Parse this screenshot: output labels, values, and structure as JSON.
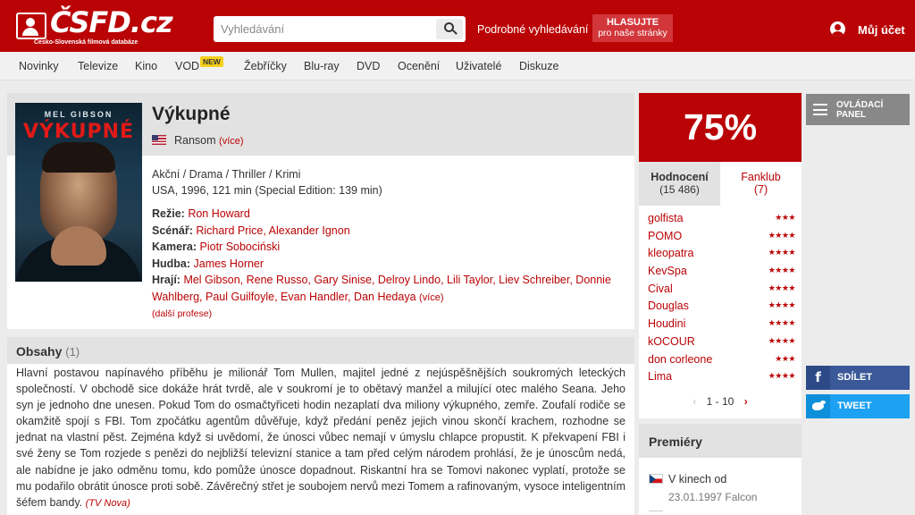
{
  "header": {
    "logo_text": "ČSFD.cz",
    "logo_subtitle": "Česko-Slovenská filmová databáze",
    "search_placeholder": "Vyhledávání",
    "advanced_search": "Podrobné vyhledávání",
    "vote_line1": "HLASUJTE",
    "vote_line2": "pro naše stránky",
    "account": "Můj účet"
  },
  "nav": {
    "items": [
      "Novinky",
      "Televize",
      "Kino",
      "VOD",
      "Žebříčky",
      "Blu-ray",
      "DVD",
      "Ocenění",
      "Uživatelé",
      "Diskuze"
    ],
    "new_badge": "NEW"
  },
  "film": {
    "poster_actor": "MEL GIBSON",
    "poster_title": "VÝKUPNÉ",
    "title": "Výkupné",
    "original_title": "Ransom",
    "more_link": "(více)",
    "genres": "Akční / Drama / Thriller / Krimi",
    "origin": "USA, 1996, 121 min (Special Edition: 139 min)",
    "director_label": "Režie:",
    "director": "Ron Howard",
    "writers_label": "Scénář:",
    "writers": "Richard Price, Alexander Ignon",
    "camera_label": "Kamera:",
    "camera": "Piotr Sobociński",
    "music_label": "Hudba:",
    "music": "James Horner",
    "cast_label": "Hrají:",
    "cast": "Mel Gibson, Rene Russo, Gary Sinise, Delroy Lindo, Lili Taylor, Liev Schreiber, Donnie Wahlberg, Paul Guilfoyle, Evan Handler, Dan Hedaya",
    "cast_more": "(více)",
    "other_professions": "(další profese)"
  },
  "plot": {
    "title": "Obsahy",
    "count": "(1)",
    "text": "Hlavní postavou napínavého příběhu je milionář Tom Mullen, majitel jedné z nejúspěšnějších soukromých leteckých společností. V obchodě sice dokáže hrát tvrdě, ale v soukromí je to obětavý manžel a milující otec malého Seana. Jeho syn je jednoho dne unesen. Pokud Tom do osmačtyřiceti hodin nezaplatí dva miliony výkupného, zemře. Zoufalí rodiče se okamžitě spojí s FBI. Tom zpočátku agentům důvěřuje, když předání peněz jejich vinou skončí krachem, rozhodne se jednat na vlastní pěst. Zejména když si uvědomí, že únosci vůbec nemají v úmyslu chlapce propustit. K překvapení FBI i své ženy se Tom rozjede s penězi do nejbližší televizní stanice a tam před celým národem prohlásí, že je únoscům nedá, ale nabídne je jako odměnu tomu, kdo pomůže únosce dopadnout. Riskantní hra se Tomovi nakonec vyplatí, protože se mu podařilo obrátit únosce proti sobě. Závěrečný střet je soubojem nervů mezi Tomem a rafinovaným, vysoce inteligentním šéfem bandy.",
    "source": "(TV Nova)"
  },
  "rating": {
    "percent": "75%",
    "tab_ratings_label": "Hodnocení",
    "tab_ratings_count": "(15 486)",
    "tab_fanclub_label": "Fanklub",
    "tab_fanclub_count": "(7)",
    "users": [
      {
        "name": "golfista",
        "stars": "★★★"
      },
      {
        "name": "POMO",
        "stars": "★★★★"
      },
      {
        "name": "kleopatra",
        "stars": "★★★★"
      },
      {
        "name": "KevSpa",
        "stars": "★★★★"
      },
      {
        "name": "Cival",
        "stars": "★★★★"
      },
      {
        "name": "Douglas",
        "stars": "★★★★"
      },
      {
        "name": "Houdini",
        "stars": "★★★★"
      },
      {
        "name": "kOCOUR",
        "stars": "★★★★"
      },
      {
        "name": "don corleone",
        "stars": "★★★"
      },
      {
        "name": "Lima",
        "stars": "★★★★"
      }
    ],
    "pager": "1 - 10"
  },
  "premieres": {
    "title": "Premiéry",
    "item_label": "V kinech od",
    "item_detail": "23.01.1997 Falcon"
  },
  "sidebar": {
    "control_panel_line1": "OVLÁDACÍ",
    "control_panel_line2": "PANEL",
    "share": "SDÍLET",
    "tweet": "TWEET"
  },
  "colors": {
    "brand_red": "#ba0305",
    "facebook": "#3b5998",
    "twitter": "#1da1f2"
  }
}
